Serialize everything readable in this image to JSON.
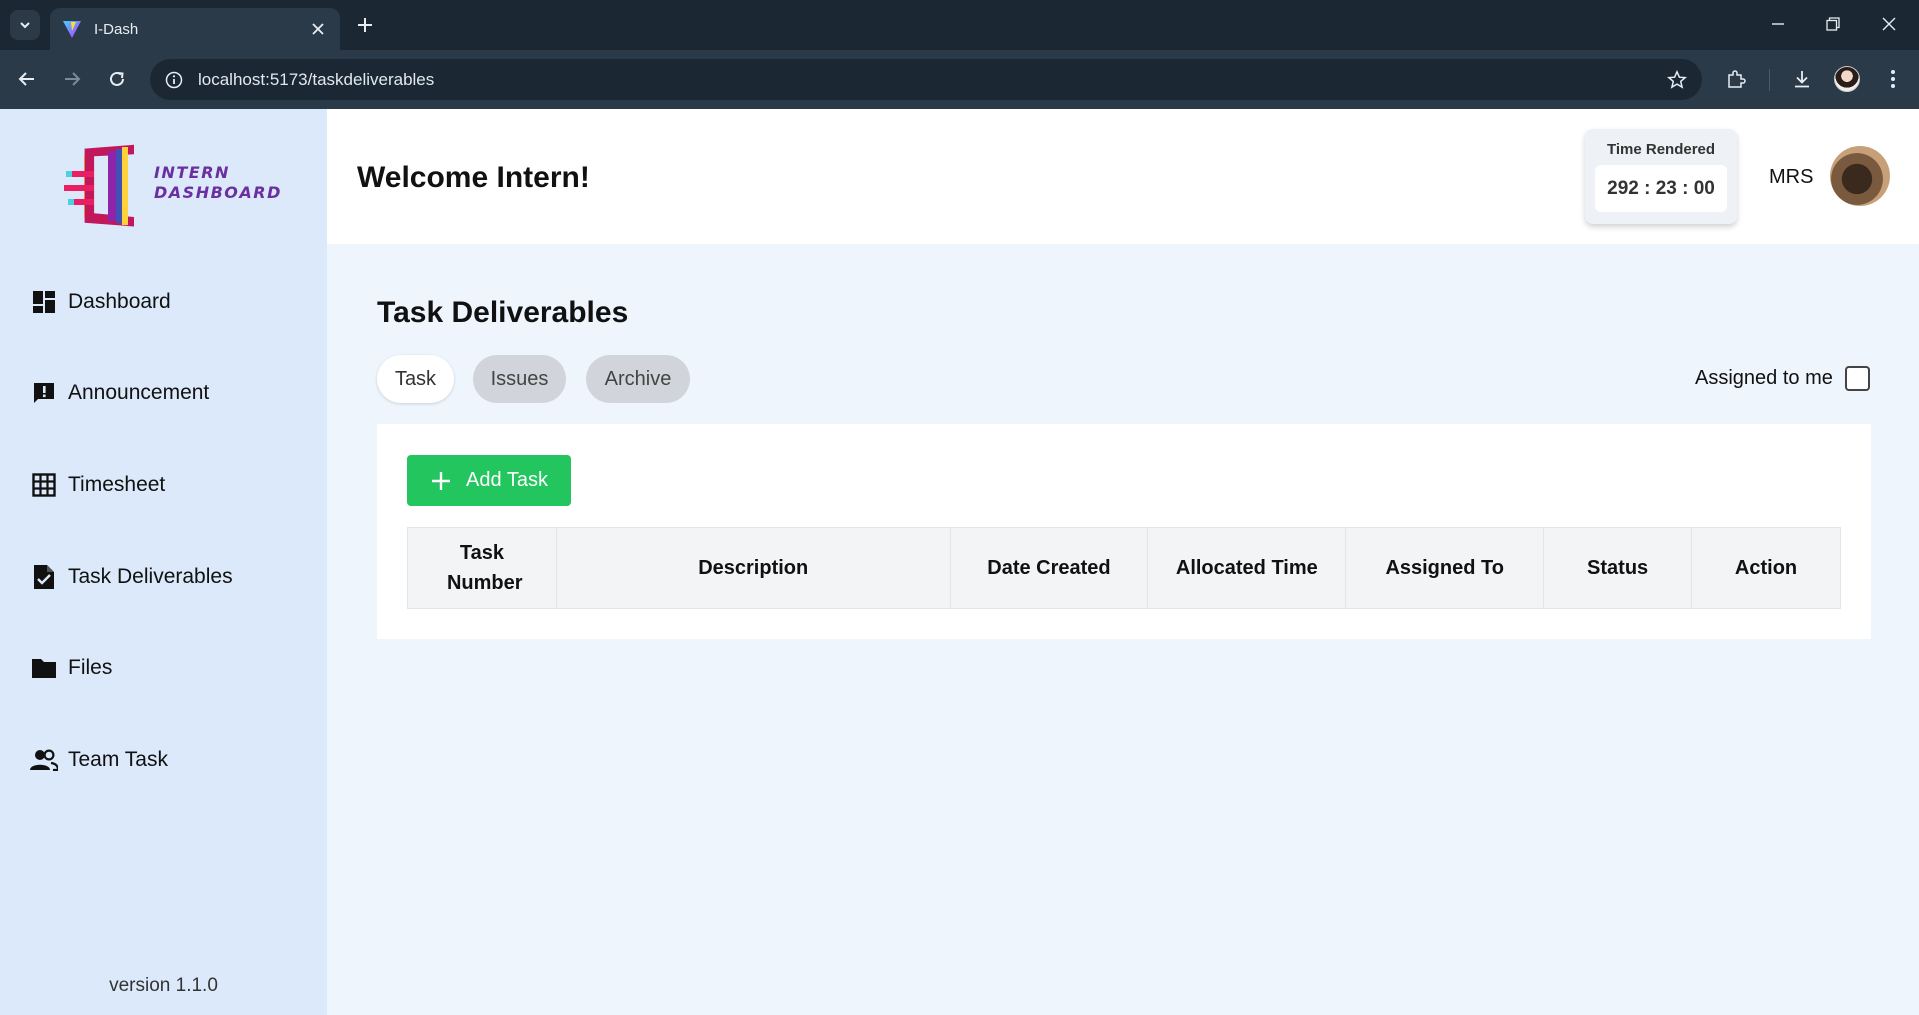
{
  "browser": {
    "tab_title": "I-Dash",
    "url": "localhost:5173/taskdeliverables"
  },
  "sidebar": {
    "logo_line1": "INTERN",
    "logo_line2": "DASHBOARD",
    "items": [
      {
        "label": "Dashboard",
        "icon": "dashboard-icon"
      },
      {
        "label": "Announcement",
        "icon": "announcement-icon"
      },
      {
        "label": "Timesheet",
        "icon": "grid-icon"
      },
      {
        "label": "Task Deliverables",
        "icon": "task-file-icon"
      },
      {
        "label": "Files",
        "icon": "folder-icon"
      },
      {
        "label": "Team Task",
        "icon": "team-icon"
      }
    ],
    "version": "version 1.1.0"
  },
  "header": {
    "welcome": "Welcome Intern!",
    "time_label": "Time Rendered",
    "time_value": "292 : 23 : 00",
    "user_initials": "MRS"
  },
  "main": {
    "title": "Task Deliverables",
    "tabs": [
      {
        "label": "Task",
        "active": true
      },
      {
        "label": "Issues",
        "active": false
      },
      {
        "label": "Archive",
        "active": false
      }
    ],
    "assigned_label": "Assigned to me",
    "assigned_checked": false,
    "add_button": "Add Task",
    "table_headers": [
      "Task Number",
      "Description",
      "Date Created",
      "Allocated Time",
      "Assigned To",
      "Status",
      "Action"
    ]
  },
  "colors": {
    "sidebar_bg": "#dbe9fb",
    "main_bg": "#eef5fd",
    "add_button": "#22c55e",
    "browser_dark": "#1b2733"
  }
}
